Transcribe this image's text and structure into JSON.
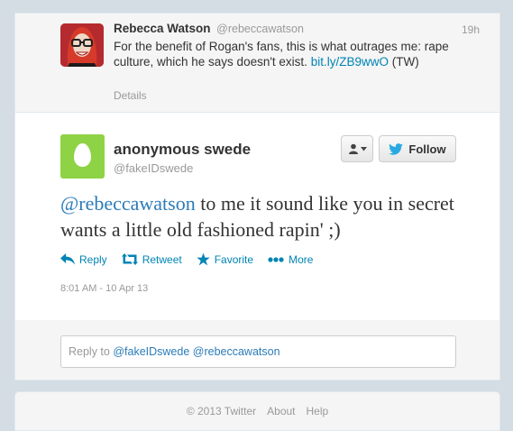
{
  "colors": {
    "link": "#0084b4",
    "mention": "#2b7bb9",
    "egg_bg": "#8ed345",
    "background": "#d4dde4"
  },
  "ancestor": {
    "name": "Rebecca Watson",
    "handle": "@rebeccawatson",
    "time": "19h",
    "text_before_link": "For the benefit of Rogan's fans, this is what outrages me: rape culture, which he says doesn't exist. ",
    "link": "bit.ly/ZB9wwO",
    "text_after_link": " (TW)",
    "details": "Details"
  },
  "main": {
    "name": "anonymous swede",
    "handle": "@fakeIDswede",
    "follow_label": "Follow",
    "mention": "@rebeccawatson",
    "text": " to me it sound like you in secret wants a little old fashioned rapin' ;)",
    "actions": [
      {
        "label": "Reply",
        "icon": "reply-icon"
      },
      {
        "label": "Retweet",
        "icon": "retweet-icon"
      },
      {
        "label": "Favorite",
        "icon": "star-icon"
      },
      {
        "label": "More",
        "icon": "more-icon"
      }
    ],
    "timestamp": "8:01 AM - 10 Apr 13"
  },
  "reply": {
    "prefix": "Reply to ",
    "mentions": "@fakeIDswede @rebeccawatson"
  },
  "footer": {
    "copyright": "© 2013 Twitter",
    "links": [
      "About",
      "Help"
    ]
  }
}
